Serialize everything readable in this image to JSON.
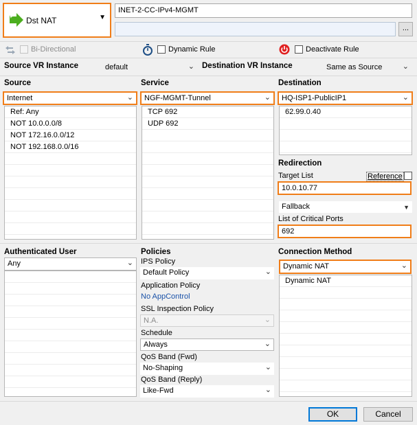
{
  "header": {
    "action": "Dst NAT",
    "rule_name": "INET-2-CC-IPv4-MGMT",
    "description": "",
    "browse_label": "..."
  },
  "options": {
    "bidirectional": "Bi-Directional",
    "dynamic_rule": "Dynamic Rule",
    "deactivate_rule": "Deactivate Rule"
  },
  "vr": {
    "source_label": "Source VR Instance",
    "source_value": "default",
    "dest_label": "Destination VR Instance",
    "dest_value": "Same as Source"
  },
  "source": {
    "label": "Source",
    "value": "Internet",
    "items": [
      "Ref: Any",
      "NOT 10.0.0.0/8",
      "NOT 172.16.0.0/12",
      "NOT 192.168.0.0/16",
      "",
      "",
      "",
      "",
      "",
      "",
      "",
      ""
    ]
  },
  "service": {
    "label": "Service",
    "value": "NGF-MGMT-Tunnel",
    "items": [
      "TCP  692",
      "UDP  692",
      "",
      "",
      "",
      "",
      "",
      "",
      "",
      "",
      "",
      ""
    ]
  },
  "destination": {
    "label": "Destination",
    "value": "HQ-ISP1-PublicIP1",
    "items": [
      "62.99.0.40",
      "",
      "",
      ""
    ]
  },
  "redirection": {
    "label": "Redirection",
    "target_list_label": "Target List",
    "reference_label": "Reference",
    "target_value": "10.0.10.77",
    "fallback_value": "Fallback",
    "critical_ports_label": "List of Critical Ports",
    "critical_ports_value": "692"
  },
  "auth_user": {
    "label": "Authenticated User",
    "value": "Any",
    "items": [
      "",
      "",
      "",
      "",
      "",
      "",
      "",
      "",
      "",
      "",
      ""
    ]
  },
  "policies": {
    "label": "Policies",
    "ips_label": "IPS Policy",
    "ips_value": "Default Policy",
    "app_label": "Application Policy",
    "app_value": "No AppControl",
    "ssl_label": "SSL Inspection Policy",
    "ssl_value": "N.A.",
    "schedule_label": "Schedule",
    "schedule_value": "Always",
    "qos_fwd_label": "QoS Band (Fwd)",
    "qos_fwd_value": "No-Shaping",
    "qos_reply_label": "QoS Band (Reply)",
    "qos_reply_value": "Like-Fwd"
  },
  "connection": {
    "label": "Connection Method",
    "value": "Dynamic NAT",
    "items": [
      "Dynamic NAT",
      "",
      "",
      "",
      "",
      "",
      "",
      "",
      "",
      ""
    ]
  },
  "footer": {
    "ok": "OK",
    "cancel": "Cancel"
  },
  "colors": {
    "highlight": "#f07d18",
    "action_icon": "#4cae1f",
    "deactivate_icon": "#e02020",
    "link": "#1a52a8"
  }
}
